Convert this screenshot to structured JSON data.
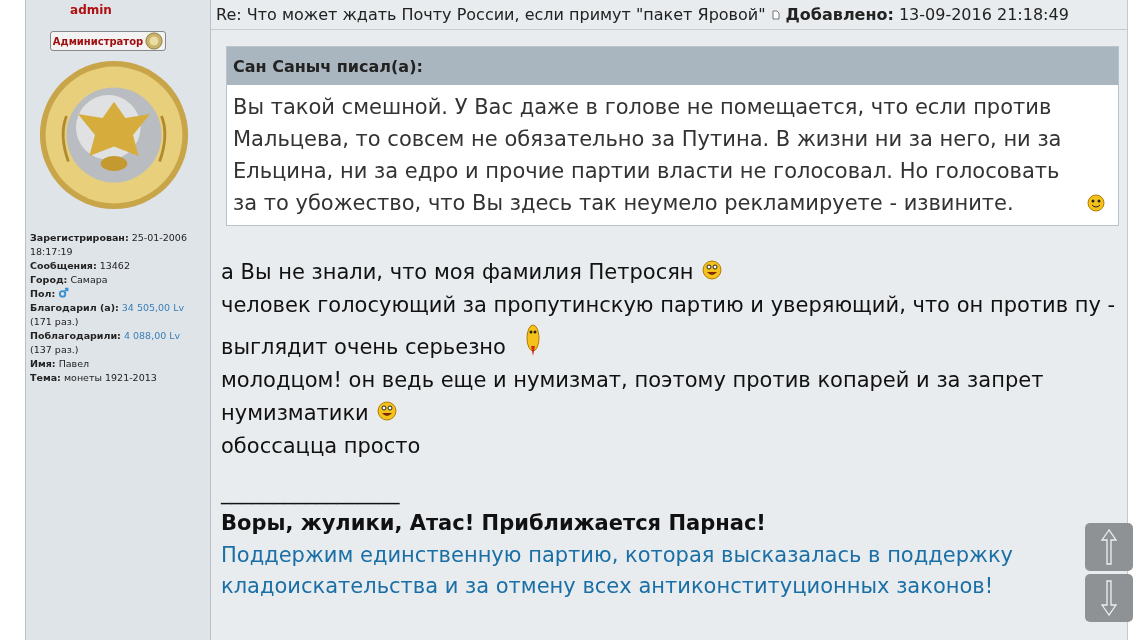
{
  "header": {
    "author": "admin",
    "title": "Re: Что может ждать Почту России, если примут \"пакет Яровой\"",
    "added_label": "Добавлено:",
    "date": "13-09-2016 21:18:49"
  },
  "sidebar": {
    "rank": "Администратор",
    "fields": [
      {
        "label": "Зарегистрирован:",
        "value": "25-01-2006 18:17:19",
        "kind": "text"
      },
      {
        "label": "Сообщения:",
        "value": "13462",
        "kind": "text"
      },
      {
        "label": "Город:",
        "value": "Самара",
        "kind": "text"
      },
      {
        "label": "Пол:",
        "kind": "male"
      },
      {
        "label": "Благодарил (а):",
        "value": "34 505,00 Lv",
        "note": "(171 раз.)",
        "kind": "link"
      },
      {
        "label": "Поблагодарили:",
        "value": "4 088,00 Lv",
        "note": "(137 раз.)",
        "kind": "link"
      },
      {
        "label": "Имя:",
        "value": "Павел",
        "kind": "text"
      },
      {
        "label": "Тема:",
        "value": "монеты 1921-2013",
        "kind": "text"
      }
    ]
  },
  "quote": {
    "author": "Сан Саныч писал(а):",
    "text": "Вы такой смешной. У Вас даже в голове не помещается, что если против Мальцева, то совсем не обязательно за Путина. В жизни ни за него, ни за Ельцина, ни за едро и прочие партии власти не голосовал. Но голосовать за то убожество, что Вы здесь так неумело рекламируете - извините.",
    "smiley": {
      "kind": "grin"
    }
  },
  "lines": [
    {
      "kind": "text",
      "text": "а Вы не знали, что моя фамилия Петросян",
      "smiley": {
        "kind": "grin"
      }
    },
    {
      "kind": "text",
      "text": "человек голосующий за пропутинскую партию и уверяющий, что он против пу -"
    },
    {
      "kind": "text",
      "text": "выглядит очень серьезно",
      "smiley": {
        "kind": "tall"
      }
    },
    {
      "kind": "text",
      "text": "молодцом! он ведь еще и нумизмат, поэтому против копарей и за запрет"
    },
    {
      "kind": "text",
      "text": "нумизматики",
      "smiley": {
        "kind": "grin"
      }
    },
    {
      "kind": "text",
      "text": "обоссацца просто"
    },
    {
      "kind": "rule",
      "text": "_________________"
    },
    {
      "kind": "bold",
      "text": "Воры, жулики, Атас! Приближается Парнас!"
    },
    {
      "kind": "link",
      "text": "Поддержим единственную партию, которая высказалась в поддержку"
    },
    {
      "kind": "link",
      "text": "кладоискательства и за отмену всех антиконституционных законов!"
    }
  ]
}
